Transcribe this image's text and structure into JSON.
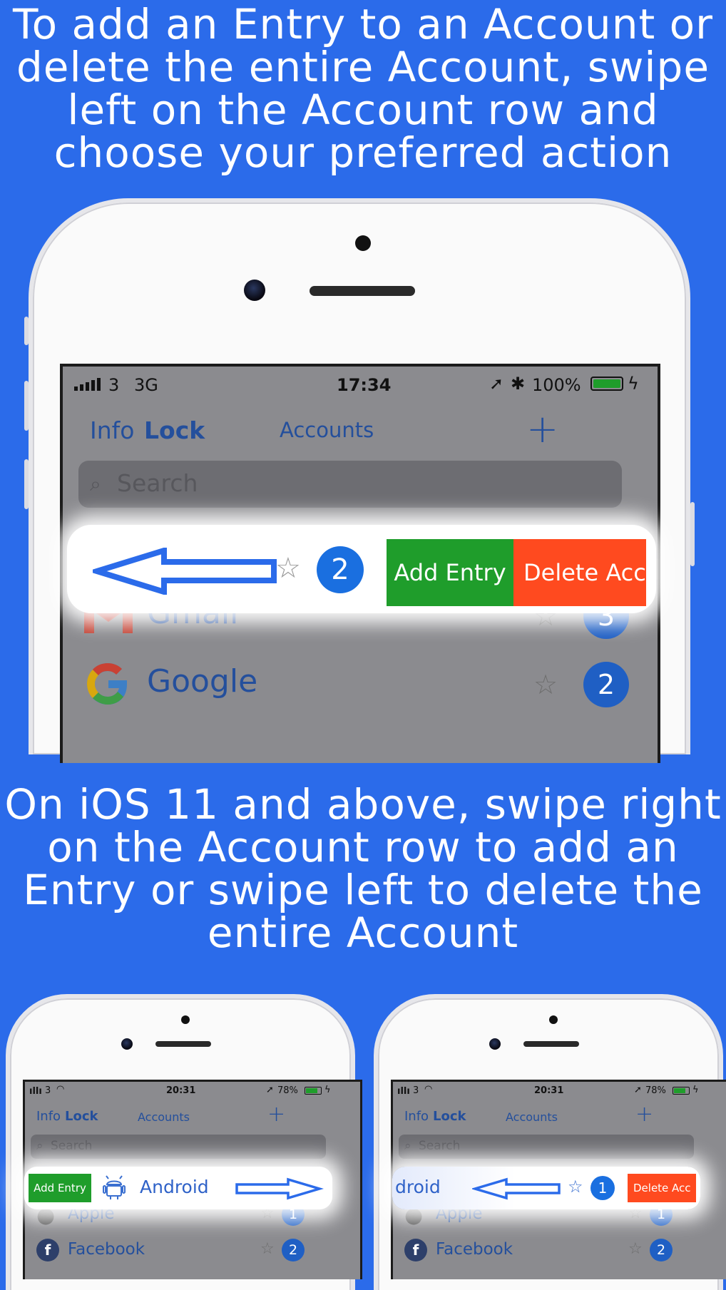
{
  "captions": {
    "top": "To add an Entry to an Account or delete the entire Account, swipe left on the Account row and choose your preferred action",
    "middle": "On iOS 11 and above, swipe right on the Account row to add an Entry or swipe left to delete the entire Account"
  },
  "colors": {
    "background": "#2b6bea",
    "add_action": "#1f9d2b",
    "delete_action": "#ff4a1f",
    "badge": "#1f5fc4"
  },
  "big_phone": {
    "status": {
      "signal": "3",
      "network": "3G",
      "time": "17:34",
      "battery": "100%"
    },
    "nav": {
      "info": "Info",
      "lock": "Lock",
      "title": "Accounts",
      "add_icon": "plus-icon"
    },
    "search_placeholder": "Search",
    "swiped_row": {
      "count": "2",
      "add_label": "Add Entry",
      "delete_label": "Delete Acc"
    },
    "rows": [
      {
        "name": "Gmail",
        "count": "3",
        "icon": "gmail-logo-icon"
      },
      {
        "name": "Google",
        "count": "2",
        "icon": "google-logo-icon"
      }
    ]
  },
  "left_phone": {
    "status": {
      "signal": "3",
      "time": "20:31",
      "battery": "78%"
    },
    "nav": {
      "info": "Info",
      "lock": "Lock",
      "title": "Accounts"
    },
    "search_placeholder": "Search",
    "swiped_row": {
      "add_label": "Add Entry",
      "name": "Android",
      "icon": "android-icon"
    },
    "rows": [
      {
        "name": "Apple",
        "count": "1",
        "icon": "apple-logo-icon"
      },
      {
        "name": "Facebook",
        "count": "2",
        "icon": "facebook-logo-icon"
      }
    ]
  },
  "right_phone": {
    "status": {
      "signal": "3",
      "time": "20:31",
      "battery": "78%"
    },
    "nav": {
      "info": "Info",
      "lock": "Lock",
      "title": "Accounts"
    },
    "search_placeholder": "Search",
    "swiped_row": {
      "name_partial": "droid",
      "count": "1",
      "delete_label": "Delete Acc"
    },
    "rows": [
      {
        "name": "Apple",
        "count": "1",
        "icon": "apple-logo-icon"
      },
      {
        "name": "Facebook",
        "count": "2",
        "icon": "facebook-logo-icon"
      }
    ]
  }
}
